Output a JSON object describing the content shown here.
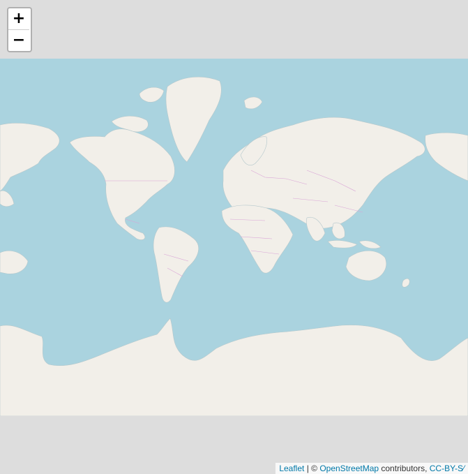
{
  "zoom": {
    "in_label": "+",
    "out_label": "−"
  },
  "attribution": {
    "leaflet": "Leaflet",
    "sep": " | © ",
    "osm": "OpenStreetMap",
    "contributors": " contributors, ",
    "license": "CC-BY-S⁄"
  },
  "colors": {
    "ocean": "#aad3df",
    "land": "#f2efe9",
    "border": "#d9a4d6",
    "background": "#dddddd"
  }
}
